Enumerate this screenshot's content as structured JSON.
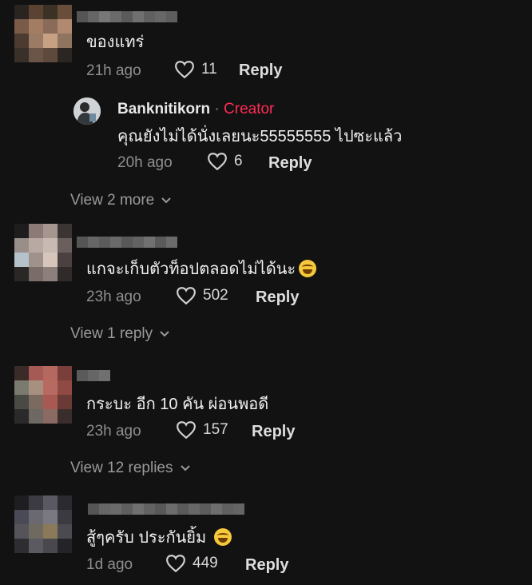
{
  "comments": [
    {
      "text": "ของแทร่",
      "time": "21h ago",
      "likes": "11",
      "reply_label": "Reply",
      "avatar_colors": [
        "#2a2420",
        "#5a4332",
        "#3c3125",
        "#6a4c3a",
        "#7a5b48",
        "#a27d63",
        "#8a6a58",
        "#b08a70",
        "#4b3b30",
        "#9b7b64",
        "#c7a184",
        "#8f7460",
        "#3a302a",
        "#6b5548",
        "#5e4a3d",
        "#2c2622"
      ],
      "name_colors": [
        "#555",
        "#666",
        "#777",
        "#6a6a6a",
        "#5a5a5a",
        "#707070",
        "#606060",
        "#676767",
        "#5e5e5e"
      ]
    },
    {
      "text": "แกจะเก็บตัวท็อปตลอดไม่ได้นะ",
      "time": "23h ago",
      "likes": "502",
      "reply_label": "Reply",
      "avatar_colors": [
        "#1d1d1d",
        "#8b7a76",
        "#a69690",
        "#3a3432",
        "#9a8e8a",
        "#b9a9a3",
        "#c8b9b2",
        "#6a5f5c",
        "#b6c2ca",
        "#9f918c",
        "#d7c4bb",
        "#4a4140",
        "#2a2727",
        "#7a6d69",
        "#8d7f7b",
        "#302b2a"
      ],
      "name_colors": [
        "#555",
        "#666",
        "#5c5c5c",
        "#6a6a6a",
        "#585858",
        "#626262",
        "#717171",
        "#5a5a5a",
        "#6b6b6b"
      ]
    },
    {
      "text": "กระบะ อีก 10 คัน ผ่อนพอดี",
      "time": "23h ago",
      "likes": "157",
      "reply_label": "Reply",
      "avatar_colors": [
        "#3a2a28",
        "#a65a55",
        "#b56860",
        "#7a3f3a",
        "#7b7a6e",
        "#a89080",
        "#b66a62",
        "#8f4a44",
        "#4a4a44",
        "#7a6a60",
        "#a85a52",
        "#6a3a36",
        "#2a2a2a",
        "#6e6862",
        "#8a6a62",
        "#3a2e2c"
      ],
      "name_colors": [
        "#5a5a5a",
        "#666",
        "#707070"
      ]
    },
    {
      "text": "สู้ๆครับ ประกันยิ้ม",
      "time": "1d ago",
      "likes": "449",
      "reply_label": "Reply",
      "avatar_colors": [
        "#1e1e22",
        "#3c3a42",
        "#5a5862",
        "#2a2a30",
        "#4a4a56",
        "#6a6870",
        "#7a7880",
        "#3a3a40",
        "#55545a",
        "#6e6a60",
        "#8a7a5a",
        "#4a4a50",
        "#2e2e32",
        "#5a5a60",
        "#48484e",
        "#242428"
      ],
      "name_colors": [
        "#555",
        "#666",
        "#6a6a6a",
        "#5e5e5e",
        "#707070",
        "#626262",
        "#585858",
        "#6c6c6c",
        "#5a5a5a",
        "#676767",
        "#5c5c5c",
        "#6e6e6e",
        "#606060",
        "#656565"
      ]
    }
  ],
  "creator_reply": {
    "name": "Banknitikorn",
    "separator": "·",
    "tag": "Creator",
    "text": "คุณยังไม่ได้นั่งเลยนะ55555555 ไปซะแล้ว",
    "time": "20h ago",
    "likes": "6",
    "reply_label": "Reply"
  },
  "view_more": [
    "View 2 more",
    "View 1 reply",
    "View 12 replies"
  ],
  "icons": {
    "like": "heart-outline-icon",
    "expand": "chevron-down-icon",
    "emoji": "grinning-squint-emoji"
  }
}
